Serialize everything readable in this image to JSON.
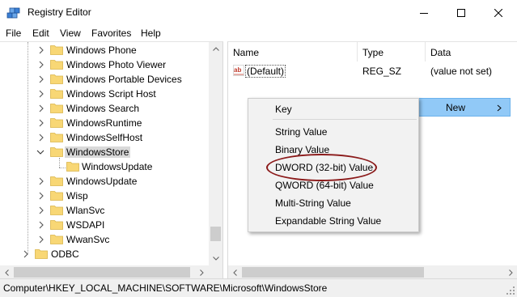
{
  "window": {
    "title": "Registry Editor",
    "minimize_glyph": "—",
    "maximize_glyph": "☐",
    "close_glyph": "✕"
  },
  "menu": {
    "file": "File",
    "edit": "Edit",
    "view": "View",
    "favorites": "Favorites",
    "help": "Help"
  },
  "tree": {
    "items": [
      {
        "label": "Windows Phone",
        "expandable": true
      },
      {
        "label": "Windows Photo Viewer",
        "expandable": true
      },
      {
        "label": "Windows Portable Devices",
        "expandable": true
      },
      {
        "label": "Windows Script Host",
        "expandable": true
      },
      {
        "label": "Windows Search",
        "expandable": true
      },
      {
        "label": "WindowsRuntime",
        "expandable": true
      },
      {
        "label": "WindowsSelfHost",
        "expandable": true
      },
      {
        "label": "WindowsStore",
        "expandable": true,
        "expanded": true,
        "selected": true
      },
      {
        "label": "WindowsUpdate",
        "expandable": false,
        "child": true
      },
      {
        "label": "WindowsUpdate",
        "expandable": true
      },
      {
        "label": "Wisp",
        "expandable": true
      },
      {
        "label": "WlanSvc",
        "expandable": true
      },
      {
        "label": "WSDAPI",
        "expandable": true
      },
      {
        "label": "WwanSvc",
        "expandable": true
      },
      {
        "label": "ODBC",
        "expandable": true,
        "level": "parent"
      }
    ]
  },
  "list": {
    "columns": {
      "name": "Name",
      "type": "Type",
      "data": "Data"
    },
    "rows": [
      {
        "name": "(Default)",
        "type": "REG_SZ",
        "data": "(value not set)",
        "icon": "string-value-icon"
      }
    ]
  },
  "context_menu": {
    "key": "Key",
    "string_value": "String Value",
    "binary_value": "Binary Value",
    "dword_value": "DWORD (32-bit) Value",
    "qword_value": "QWORD (64-bit) Value",
    "multi_string_value": "Multi-String Value",
    "expandable_string_value": "Expandable String Value"
  },
  "parent_menu": {
    "new": "New",
    "highlight_color": "#91c9f7"
  },
  "annotation": {
    "highlighted_item": "DWORD (32-bit) Value",
    "color": "#8b1a1a"
  },
  "status": {
    "path": "Computer\\HKEY_LOCAL_MACHINE\\SOFTWARE\\Microsoft\\WindowsStore"
  },
  "colors": {
    "folder": "#f8d775",
    "selection": "#d9d9d9",
    "menu_highlight": "#91c9f7"
  }
}
